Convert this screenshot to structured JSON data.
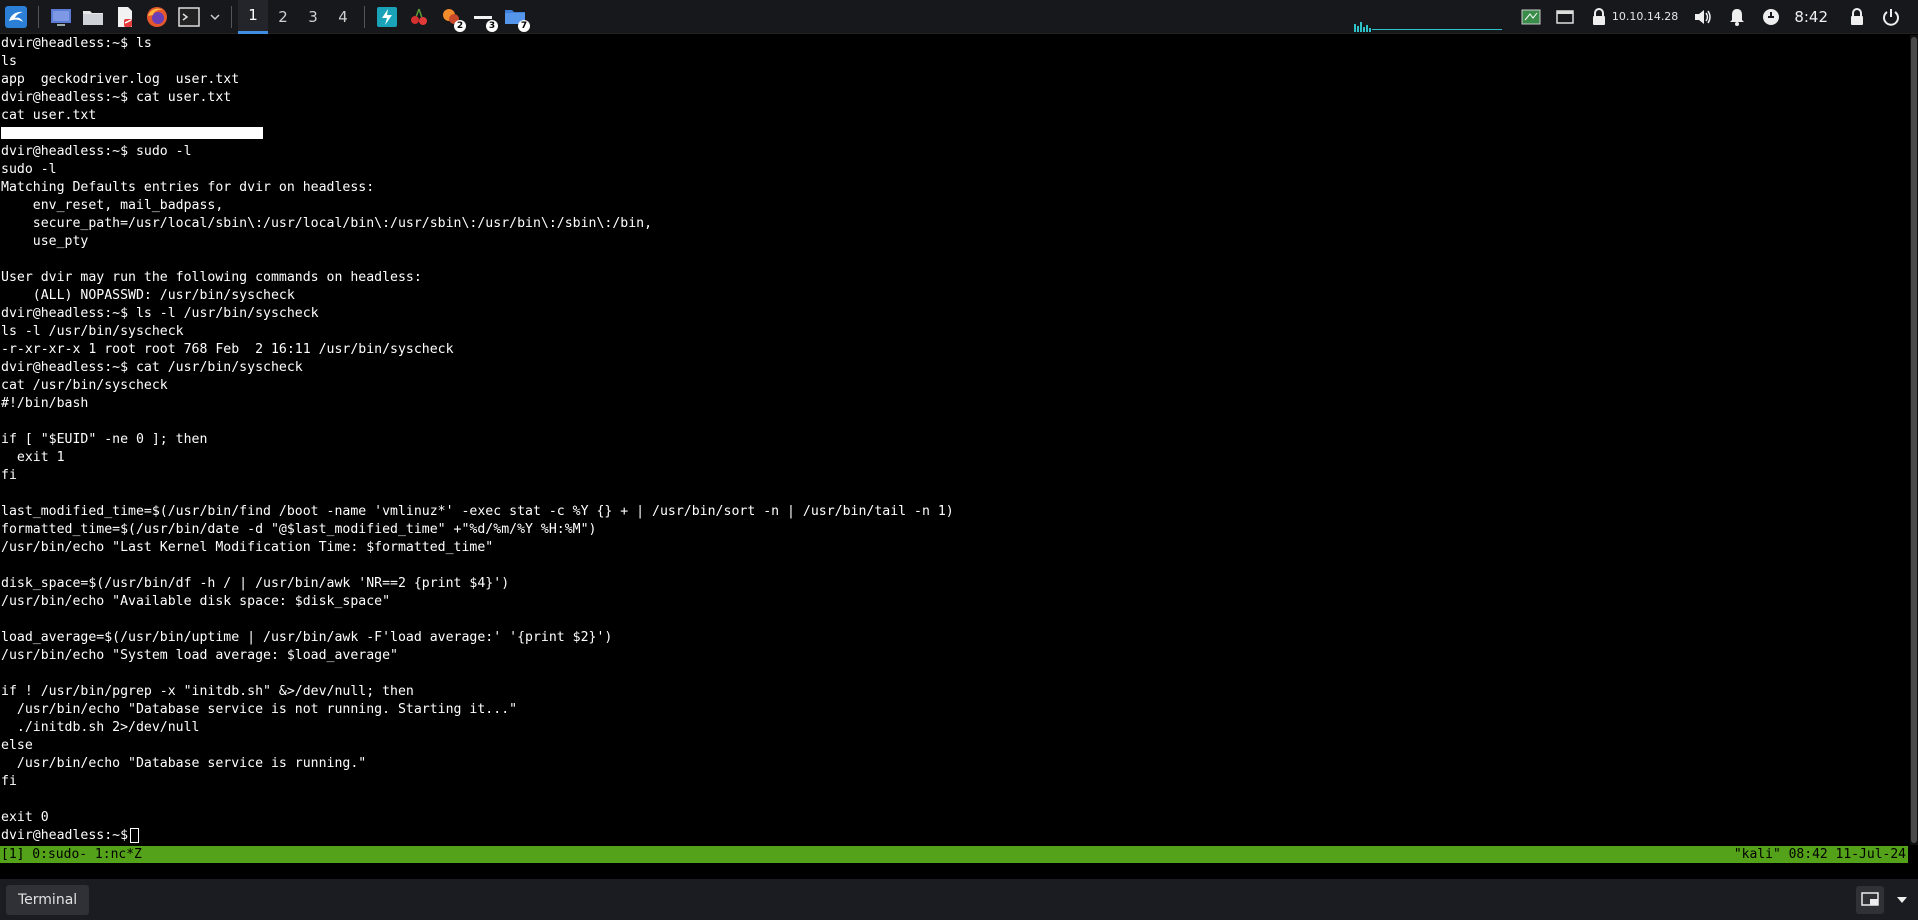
{
  "taskbar_top": {
    "workspaces": [
      "1",
      "2",
      "3",
      "4"
    ],
    "active_workspace": "1",
    "badges": {
      "app1": "2",
      "app2": "3",
      "app3": "7"
    },
    "ip_address": "10.10.14.28",
    "clock": "8:42",
    "accent_color": "#3f8ee3"
  },
  "terminal": {
    "lines": [
      "dvir@headless:~$ ls",
      "ls",
      "app  geckodriver.log  user.txt",
      "dvir@headless:~$ cat user.txt",
      "cat user.txt",
      "",
      "dvir@headless:~$ sudo -l",
      "sudo -l",
      "Matching Defaults entries for dvir on headless:",
      "    env_reset, mail_badpass,",
      "    secure_path=/usr/local/sbin\\:/usr/local/bin\\:/usr/sbin\\:/usr/bin\\:/sbin\\:/bin,",
      "    use_pty",
      "",
      "User dvir may run the following commands on headless:",
      "    (ALL) NOPASSWD: /usr/bin/syscheck",
      "dvir@headless:~$ ls -l /usr/bin/syscheck",
      "ls -l /usr/bin/syscheck",
      "-r-xr-xr-x 1 root root 768 Feb  2 16:11 /usr/bin/syscheck",
      "dvir@headless:~$ cat /usr/bin/syscheck",
      "cat /usr/bin/syscheck",
      "#!/bin/bash",
      "",
      "if [ \"$EUID\" -ne 0 ]; then",
      "  exit 1",
      "fi",
      "",
      "last_modified_time=$(/usr/bin/find /boot -name 'vmlinuz*' -exec stat -c %Y {} + | /usr/bin/sort -n | /usr/bin/tail -n 1)",
      "formatted_time=$(/usr/bin/date -d \"@$last_modified_time\" +\"%d/%m/%Y %H:%M\")",
      "/usr/bin/echo \"Last Kernel Modification Time: $formatted_time\"",
      "",
      "disk_space=$(/usr/bin/df -h / | /usr/bin/awk 'NR==2 {print $4}')",
      "/usr/bin/echo \"Available disk space: $disk_space\"",
      "",
      "load_average=$(/usr/bin/uptime | /usr/bin/awk -F'load average:' '{print $2}')",
      "/usr/bin/echo \"System load average: $load_average\"",
      "",
      "if ! /usr/bin/pgrep -x \"initdb.sh\" &>/dev/null; then",
      "  /usr/bin/echo \"Database service is not running. Starting it...\"",
      "  ./initdb.sh 2>/dev/null",
      "else",
      "  /usr/bin/echo \"Database service is running.\"",
      "fi",
      "",
      "exit 0"
    ],
    "prompt": "dvir@headless:~$ "
  },
  "tmux": {
    "left": "[1] 0:sudo- 1:nc*Z",
    "right": "\"kali\" 08:42 11-Jul-24",
    "bar_color": "#54a11a"
  },
  "taskbar_bottom": {
    "task_label": "Terminal"
  }
}
